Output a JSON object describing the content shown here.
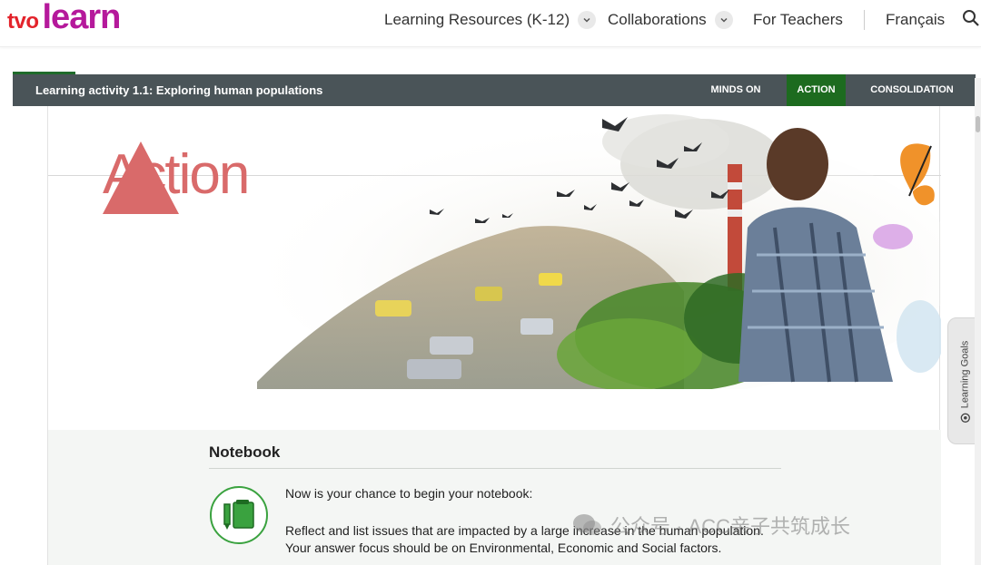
{
  "brand": {
    "part1": "tvo",
    "part2": "learn"
  },
  "nav": {
    "learning_resources": "Learning Resources (K-12)",
    "collaborations": "Collaborations",
    "for_teachers": "For Teachers",
    "language": "Français"
  },
  "activity": {
    "title": "Learning activity 1.1: Exploring human populations",
    "tabs": [
      "MINDS ON",
      "ACTION",
      "CONSOLIDATION"
    ],
    "active_tab": "ACTION"
  },
  "hero": {
    "heading": "Action"
  },
  "notebook": {
    "title": "Notebook",
    "line1": "Now is your chance to begin your notebook:",
    "line2": "Reflect and list issues that are impacted by a large increase in the human population.",
    "line3": "Your answer focus should be on Environmental, Economic and Social factors."
  },
  "side_tab": {
    "label": "Learning Goals"
  },
  "watermark": {
    "text": "公众号 · ACC亲子共筑成长"
  },
  "colors": {
    "accent_green": "#1d6b1f",
    "bar_gray": "#4a5458",
    "brand_red": "#e3232b",
    "brand_magenta": "#b5199b"
  }
}
